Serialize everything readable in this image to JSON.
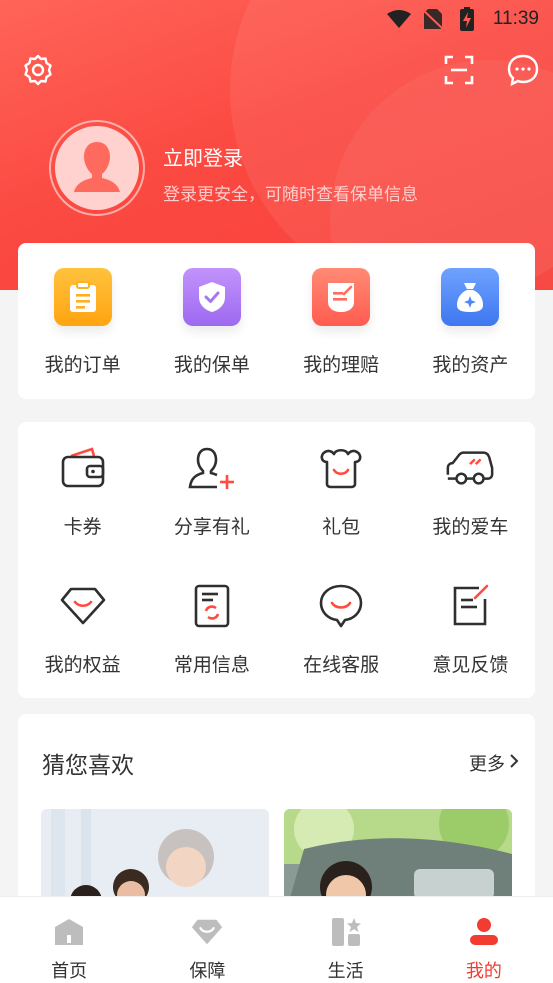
{
  "status_bar": {
    "time": "11:39"
  },
  "profile": {
    "login_title": "立即登录",
    "login_subtitle": "登录更安全，可随时查看保单信息"
  },
  "quick_actions": [
    {
      "label": "我的订单",
      "icon": "order-icon",
      "color": "#ffb020"
    },
    {
      "label": "我的保单",
      "icon": "policy-shield-icon",
      "color": "#b07cf5"
    },
    {
      "label": "我的理赔",
      "icon": "claim-icon",
      "color": "#ff6b5e"
    },
    {
      "label": "我的资产",
      "icon": "asset-bag-icon",
      "color": "#4d86f7"
    }
  ],
  "services": [
    {
      "label": "卡券",
      "icon": "wallet-card-icon"
    },
    {
      "label": "分享有礼",
      "icon": "share-user-icon"
    },
    {
      "label": "礼包",
      "icon": "gift-pack-icon"
    },
    {
      "label": "我的爱车",
      "icon": "car-icon"
    },
    {
      "label": "我的权益",
      "icon": "diamond-icon"
    },
    {
      "label": "常用信息",
      "icon": "document-sync-icon"
    },
    {
      "label": "在线客服",
      "icon": "chat-smile-icon"
    },
    {
      "label": "意见反馈",
      "icon": "feedback-edit-icon"
    }
  ],
  "recommend": {
    "title": "猜您喜欢",
    "more_label": "更多"
  },
  "bottom_nav": [
    {
      "label": "首页",
      "icon": "home-icon",
      "active": false
    },
    {
      "label": "保障",
      "icon": "protection-diamond-icon",
      "active": false
    },
    {
      "label": "生活",
      "icon": "life-grid-icon",
      "active": false
    },
    {
      "label": "我的",
      "icon": "me-user-icon",
      "active": true
    }
  ],
  "colors": {
    "brand_red": "#f7403a",
    "active_nav": "#f23c32",
    "icon_dark": "#2f2f2f"
  }
}
